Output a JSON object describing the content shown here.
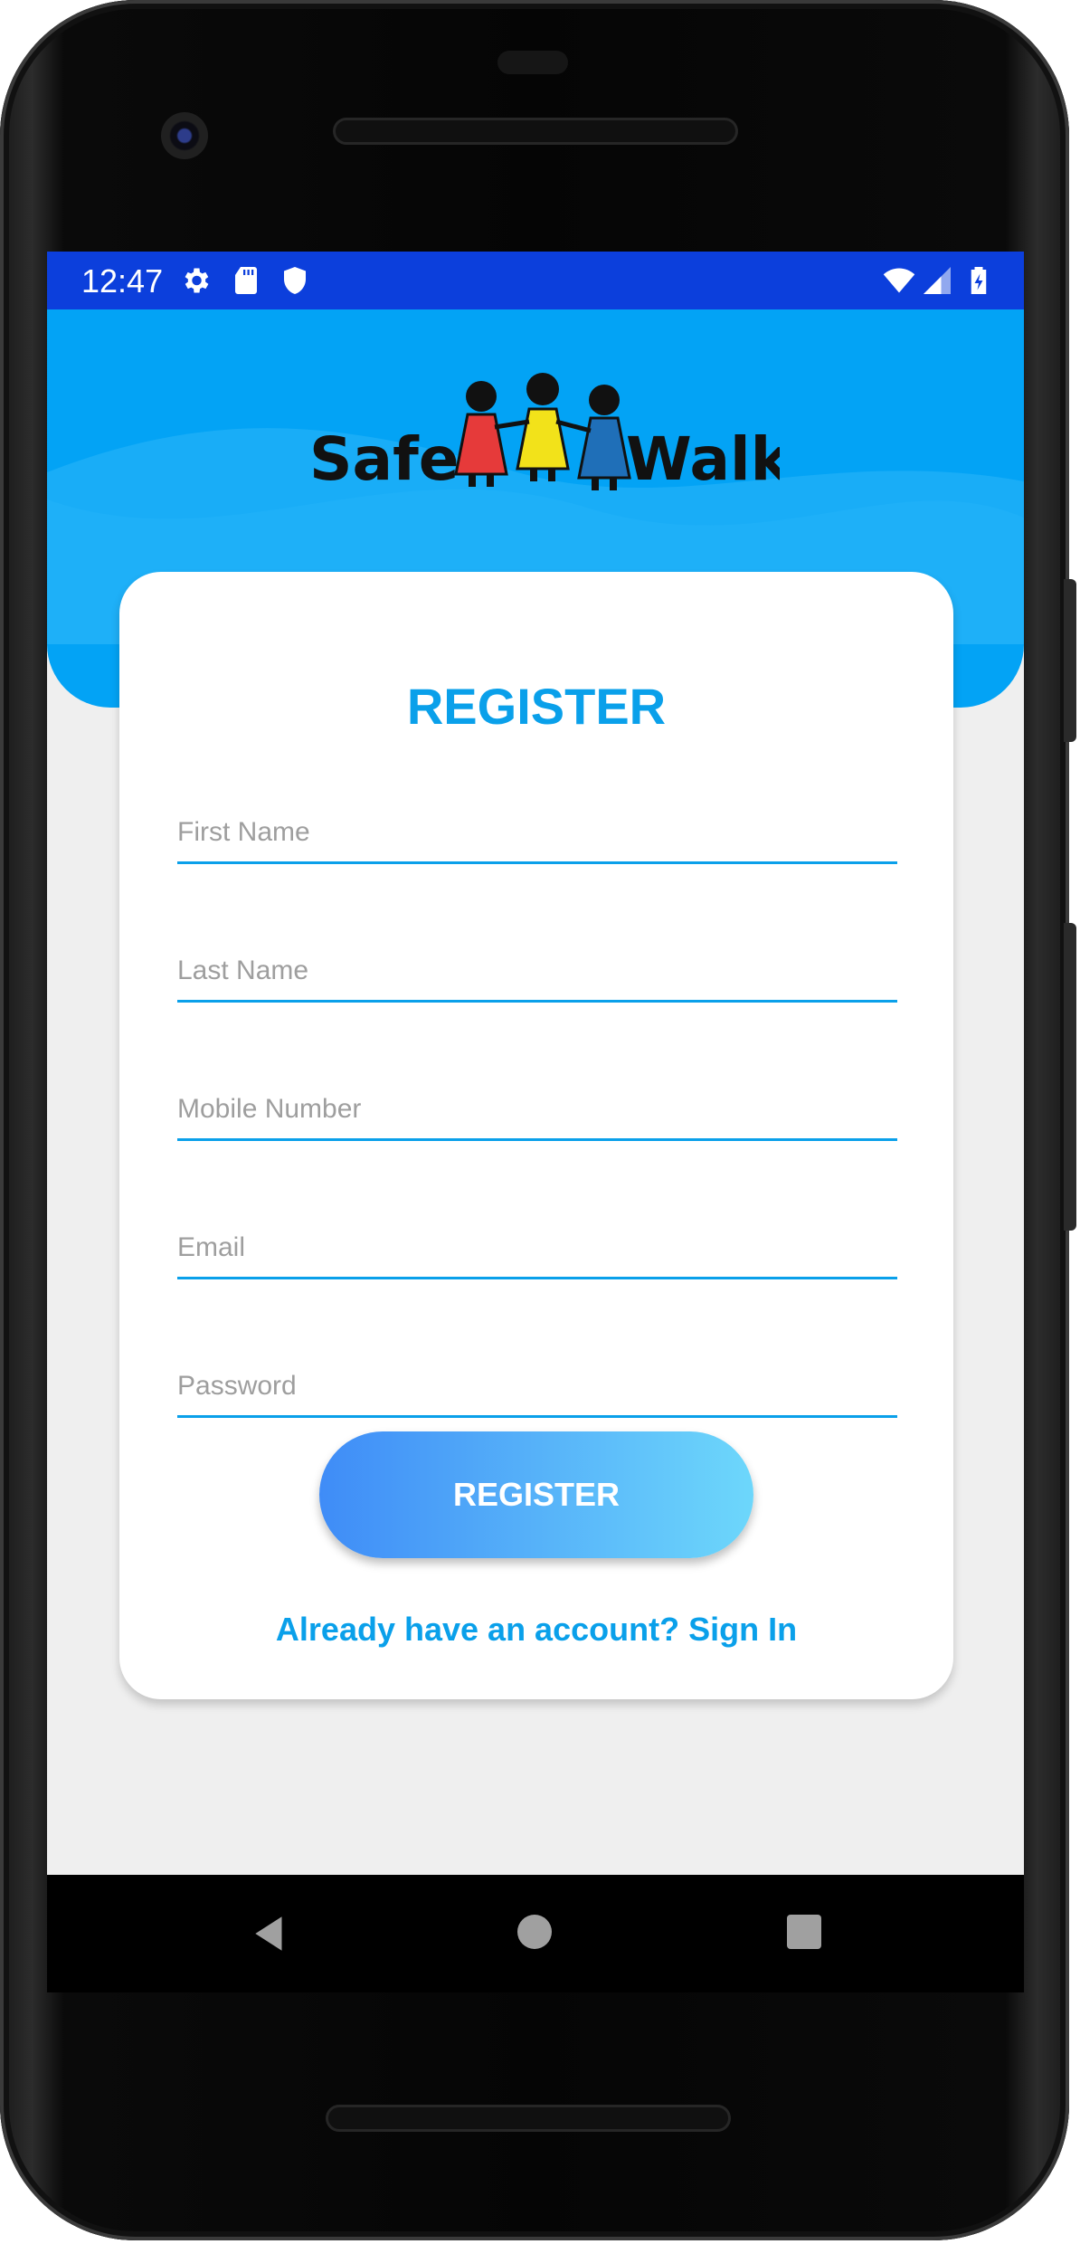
{
  "status_bar": {
    "time": "12:47",
    "left_icons": [
      "gear-icon",
      "sd-card-icon",
      "shield-icon"
    ],
    "right_icons": [
      "wifi-icon",
      "cell-signal-icon",
      "battery-charging-icon"
    ],
    "background": "#0c3fdc"
  },
  "header": {
    "logo_text": "SafeWalk",
    "background": "#03a3f5"
  },
  "form": {
    "title": "REGISTER",
    "fields": [
      {
        "placeholder": "First Name",
        "value": ""
      },
      {
        "placeholder": "Last Name",
        "value": ""
      },
      {
        "placeholder": "Mobile Number",
        "value": ""
      },
      {
        "placeholder": "Email",
        "value": ""
      },
      {
        "placeholder": "Password",
        "value": ""
      }
    ],
    "submit_label": "REGISTER",
    "signin_text": "Already have an account? Sign In",
    "accent_color": "#0aa0ea"
  },
  "nav_bar": {
    "buttons": [
      "back-icon",
      "home-icon",
      "recents-icon"
    ]
  }
}
